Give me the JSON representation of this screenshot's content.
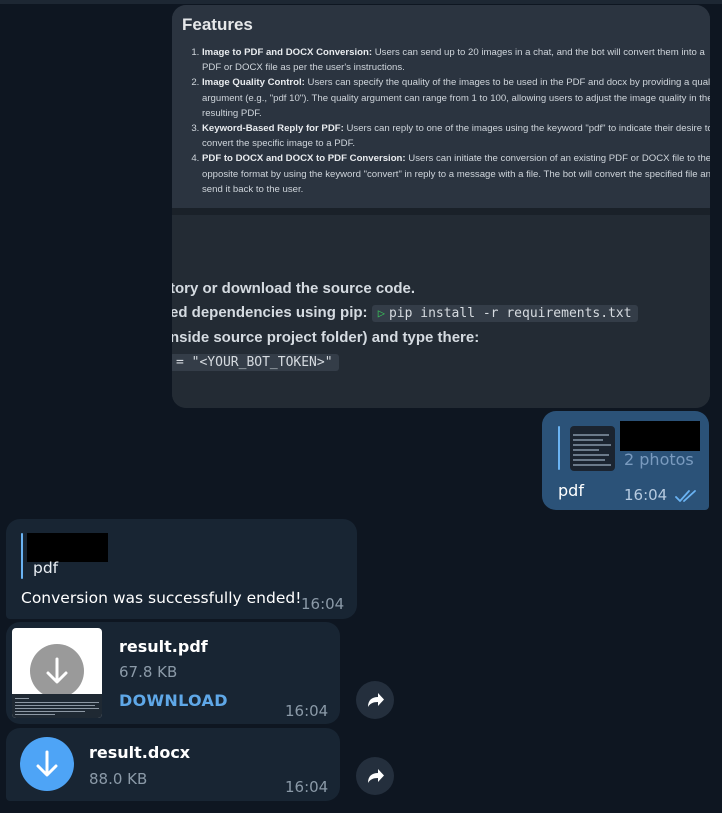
{
  "photo_message": {
    "features_title": "Features",
    "features": [
      {
        "title": "Image to PDF and DOCX Conversion:",
        "text": " Users can send up to 20 images in a chat, and the bot will convert them into a PDF or DOCX file as per the user's instructions."
      },
      {
        "title": "Image Quality Control:",
        "text": " Users can specify the quality of the images to be used in the PDF and docx by providing a quality argument (e.g., \"pdf 10\"). The quality argument can range from 1 to 100, allowing users to adjust the image quality in the resulting PDF."
      },
      {
        "title": "Keyword-Based Reply for PDF:",
        "text": " Users can reply to one of the images using the keyword \"pdf\" to indicate their desire to convert the specific image to a PDF."
      },
      {
        "title": "PDF to DOCX and DOCX to PDF Conversion:",
        "text": " Users can initiate the conversion of an existing PDF or DOCX file to the opposite format by using the keyword \"convert\" in reply to a message with a file. The bot will convert the specified file and send it back to the user."
      }
    ],
    "line1": "tory or download the source code.",
    "line2_prefix": "ed dependencies using pip: ",
    "line2_code": "pip install -r requirements.txt",
    "line3": "nside source project folder) and type there:",
    "line4_code": "= \"<YOUR_BOT_TOKEN>\""
  },
  "outgoing": {
    "reply_preview": "2 photos",
    "text": "pdf",
    "time": "16:04"
  },
  "incoming": {
    "reply_preview": "pdf",
    "text": "Conversion was successfully ended!",
    "time": "16:04"
  },
  "files": [
    {
      "name": "result.pdf",
      "size": "67.8 KB",
      "action": "DOWNLOAD",
      "time": "16:04"
    },
    {
      "name": "result.docx",
      "size": "88.0 KB",
      "time": "16:04"
    }
  ],
  "colors": {
    "background": "#0e1621",
    "outgoing_bubble": "#2b5278",
    "incoming_bubble": "#182533",
    "accent": "#5fa8e8",
    "docx_icon": "#4ea4f6"
  },
  "icons": [
    "play-icon",
    "double-check-icon",
    "download-arrow-icon",
    "share-arrow-icon"
  ]
}
